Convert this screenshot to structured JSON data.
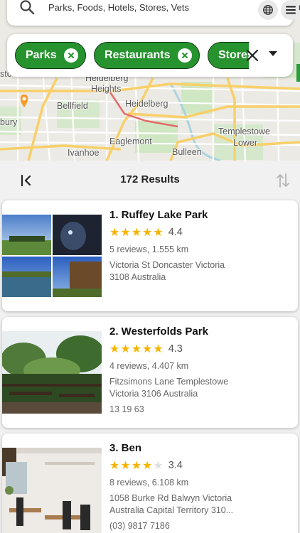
{
  "search": {
    "placeholder": "Parks, Foods, Hotels, Stores, Vets",
    "tail": "nc"
  },
  "chips": [
    {
      "label": "Parks"
    },
    {
      "label": "Restaurants"
    },
    {
      "label": "Stores"
    }
  ],
  "map": {
    "labels": {
      "heights": "Heidelberg Heights",
      "bellfield": "Bellfield",
      "heidelberg": "Heidelberg",
      "templestowe_lower_1": "Templestowe",
      "templestowe_lower_2": "Lower",
      "eaglemont": "Eaglemont",
      "ivanhoe": "Ivanhoe",
      "bulleen": "Bulleen",
      "bury": "bury",
      "sto": "sto",
      "heidelberg_top": "Heidelberg"
    },
    "colors": {
      "road_major": "#f8d06a",
      "road_minor": "#ffffff",
      "park": "#cfe7c2",
      "water": "#aad3df",
      "pin": "#f59b2b"
    }
  },
  "results": {
    "count_label": "172 Results"
  },
  "places": [
    {
      "title": "1. Ruffey Lake Park",
      "rating": "4.4",
      "stars": 5,
      "meta": "5 reviews, 1.555 km",
      "address_1": "Victoria St Doncaster Victoria",
      "address_2": "3108 Australia",
      "phone": ""
    },
    {
      "title": "2. Westerfolds Park",
      "rating": "4.3",
      "stars": 5,
      "meta": "4 reviews, 4.407 km",
      "address_1": "Fitzsimons Lane Templestowe",
      "address_2": "Victoria 3106 Australia",
      "phone": "13 19 63"
    },
    {
      "title": "3. Ben",
      "rating": "3.4",
      "stars": 4,
      "meta": "8 reviews, 6.108 km",
      "address_1": "1058 Burke Rd Balwyn Victoria",
      "address_2": "Australia Capital Territory 310...",
      "phone": "(03) 9817 7186"
    }
  ],
  "icons": {
    "search": "search-icon",
    "globe": "globe-icon",
    "menu": "menu-icon",
    "chip_close": "close-circle-icon",
    "clear": "close-icon",
    "dropdown": "caret-down-icon",
    "collapse": "collapse-left-icon",
    "sort": "sort-icon",
    "star": "star-icon"
  }
}
